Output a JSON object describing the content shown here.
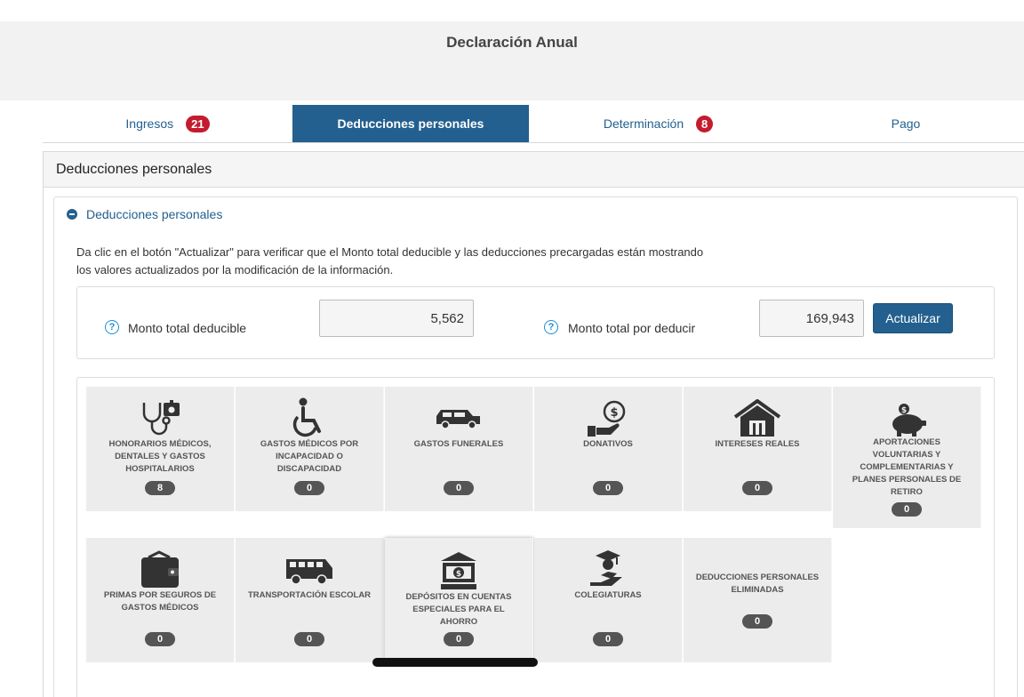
{
  "header": {
    "title": "Declaración Anual"
  },
  "tabs": [
    {
      "label": "Ingresos",
      "badge": "21"
    },
    {
      "label": "Deducciones personales",
      "badge": ""
    },
    {
      "label": "Determinación",
      "badge": "8"
    },
    {
      "label": "Pago",
      "badge": ""
    }
  ],
  "panel": {
    "title": "Deducciones personales",
    "section_title": "Deducciones personales",
    "info_line1": "Da clic en el botón \"Actualizar\" para verificar que el Monto total deducible y las deducciones precargadas están mostrando",
    "info_line2": "los valores actualizados por la modificación de la información."
  },
  "totals": {
    "deducible_label": "Monto total deducible",
    "deducible_value": "5,562",
    "por_deducir_label": "Monto total por deducir",
    "por_deducir_value": "169,943",
    "update_button": "Actualizar"
  },
  "cards": [
    {
      "label": "HONORARIOS MÉDICOS, DENTALES Y GASTOS HOSPITALARIOS",
      "count": "8",
      "icon": "stethoscope-icon"
    },
    {
      "label": "GASTOS MÉDICOS POR INCAPACIDAD O DISCAPACIDAD",
      "count": "0",
      "icon": "wheelchair-icon"
    },
    {
      "label": "GASTOS FUNERALES",
      "count": "0",
      "icon": "hearse-icon"
    },
    {
      "label": "DONATIVOS",
      "count": "0",
      "icon": "donation-icon"
    },
    {
      "label": "INTERESES REALES",
      "count": "0",
      "icon": "house-icon"
    },
    {
      "label": "APORTACIONES VOLUNTARIAS Y COMPLEMENTARIAS Y PLANES PERSONALES DE RETIRO",
      "count": "0",
      "icon": "piggy-bank-icon"
    },
    {
      "label": "PRIMAS POR SEGUROS DE GASTOS MÉDICOS",
      "count": "0",
      "icon": "wallet-icon"
    },
    {
      "label": "TRANSPORTACIÓN ESCOLAR",
      "count": "0",
      "icon": "school-bus-icon"
    },
    {
      "label": "DEPÓSITOS EN CUENTAS ESPECIALES PARA EL AHORRO",
      "count": "0",
      "icon": "bank-icon"
    },
    {
      "label": "COLEGIATURAS",
      "count": "0",
      "icon": "graduate-icon"
    },
    {
      "label": "DEDUCCIONES PERSONALES ELIMINADAS",
      "count": "0",
      "icon": ""
    }
  ],
  "colors": {
    "primary": "#23608f",
    "badge": "#c41b2e",
    "card": "#ececec",
    "count_pill": "#555555",
    "help_icon": "#1f8ed6"
  }
}
